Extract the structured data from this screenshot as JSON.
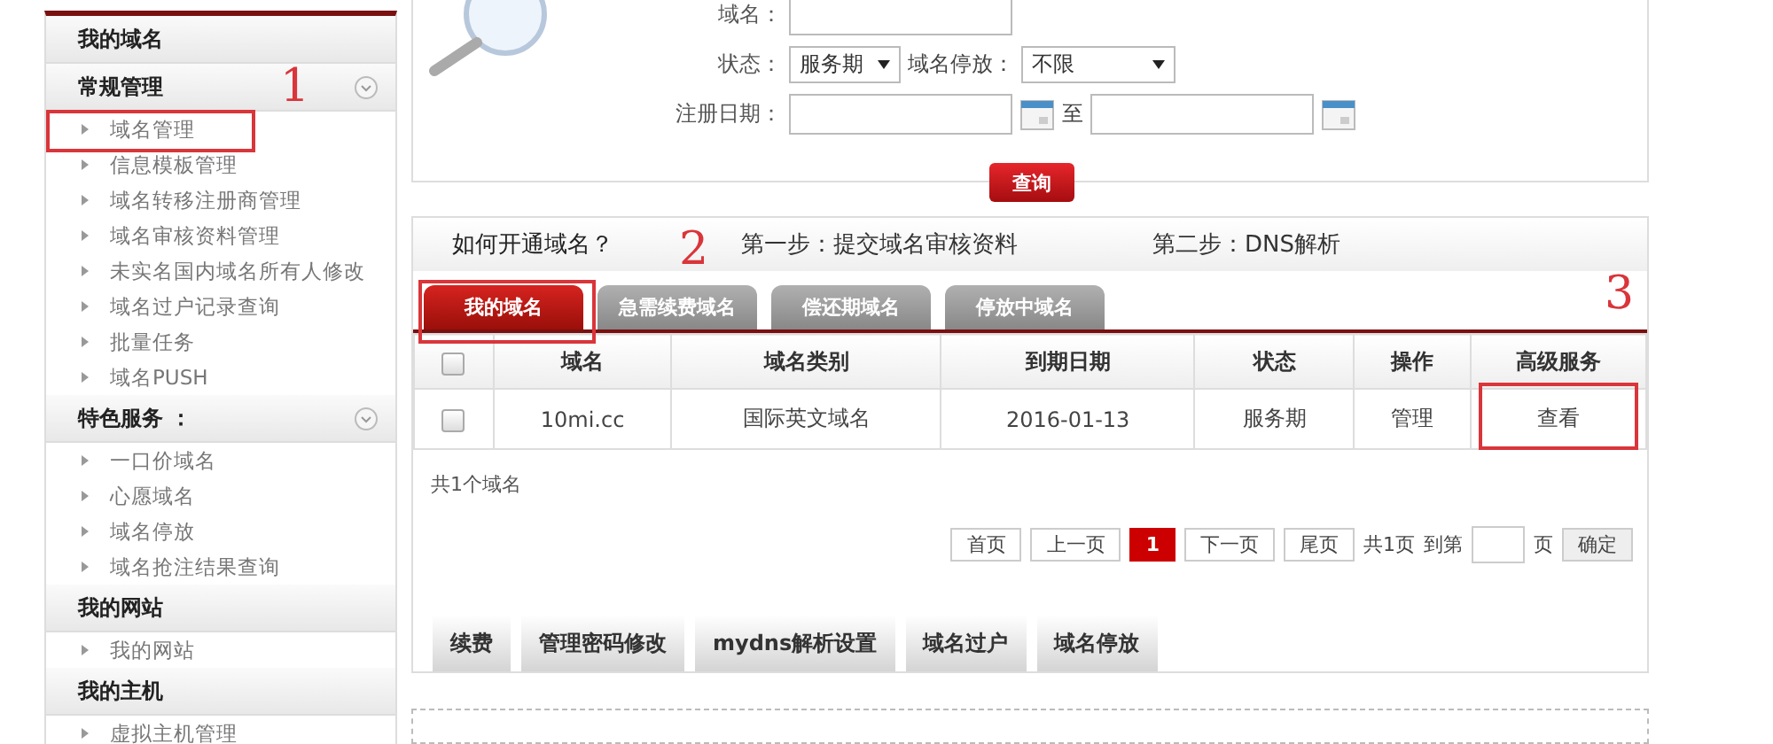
{
  "sidebar": {
    "sections": [
      {
        "title": "我的域名",
        "collapsible": false
      },
      {
        "title": "常规管理",
        "collapsible": true,
        "annotation": "1",
        "items": [
          {
            "label": "域名管理",
            "annotated": true
          },
          {
            "label": "信息模板管理",
            "annotated": false
          },
          {
            "label": "域名转移注册商管理",
            "annotated": false
          },
          {
            "label": "域名审核资料管理",
            "annotated": false
          },
          {
            "label": "未实名国内域名所有人修改",
            "annotated": false
          },
          {
            "label": "域名过户记录查询",
            "annotated": false
          },
          {
            "label": "批量任务",
            "annotated": false
          },
          {
            "label": "域名PUSH",
            "annotated": false
          }
        ]
      },
      {
        "title": "特色服务 ：",
        "collapsible": true,
        "items": [
          {
            "label": "一口价域名",
            "annotated": false
          },
          {
            "label": "心愿域名",
            "annotated": false
          },
          {
            "label": "域名停放",
            "annotated": false
          },
          {
            "label": "域名抢注结果查询",
            "annotated": false
          }
        ]
      },
      {
        "title": "我的网站",
        "collapsible": false,
        "items": [
          {
            "label": "我的网站",
            "annotated": false
          }
        ]
      },
      {
        "title": "我的主机",
        "collapsible": false,
        "items": [
          {
            "label": "虚拟主机管理",
            "annotated": false
          }
        ]
      }
    ]
  },
  "search": {
    "domain_label": "域名：",
    "status_label": "状态：",
    "status_value": "服务期",
    "parking_label": "域名停放：",
    "parking_value": "不限",
    "date_label": "注册日期：",
    "date_separator": "至",
    "query_button": "查询"
  },
  "guide": {
    "question": "如何开通域名？",
    "annotation": "2",
    "steps": [
      "第一步：提交域名审核资料",
      "第二步：DNS解析"
    ]
  },
  "tabs": [
    {
      "label": "我的域名",
      "selected": true,
      "annotated": true
    },
    {
      "label": "急需续费域名",
      "selected": false,
      "annotated": false
    },
    {
      "label": "偿还期域名",
      "selected": false,
      "annotated": false
    },
    {
      "label": "停放中域名",
      "selected": false,
      "annotated": false
    }
  ],
  "tabs_annotation": "3",
  "table": {
    "columns": [
      "域名",
      "域名类别",
      "到期日期",
      "状态",
      "操作",
      "高级服务"
    ],
    "select_all_checked": false,
    "rows": [
      {
        "checked": false,
        "cells": [
          {
            "text": "10mi.cc",
            "annotated": false
          },
          {
            "text": "国际英文域名",
            "annotated": false
          },
          {
            "text": "2016-01-13",
            "annotated": false
          },
          {
            "text": "服务期",
            "annotated": false
          },
          {
            "text": "管理",
            "annotated": false
          },
          {
            "text": "查看",
            "annotated": true
          }
        ]
      }
    ]
  },
  "summary": "共1个域名",
  "pagination": {
    "first": "首页",
    "prev": "上一页",
    "pages": [
      {
        "label": "1",
        "selected": true
      }
    ],
    "next": "下一页",
    "last": "尾页",
    "total": "共1页",
    "goto_label": "到第",
    "page_unit": "页",
    "confirm": "确定"
  },
  "actions": [
    "续费",
    "管理密码修改",
    "mydns解析设置",
    "域名过户",
    "域名停放"
  ]
}
